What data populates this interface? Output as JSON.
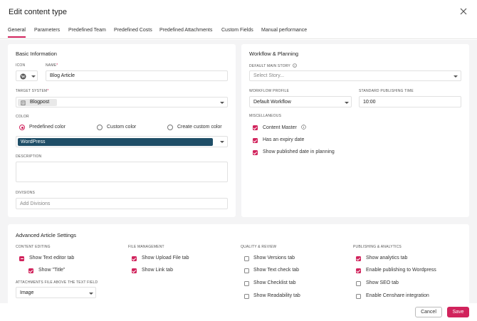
{
  "dialog": {
    "title": "Edit content type"
  },
  "tabs": [
    {
      "label": "General"
    },
    {
      "label": "Parameters"
    },
    {
      "label": "Predefined Team"
    },
    {
      "label": "Predefined Costs"
    },
    {
      "label": "Predefined Attachments"
    },
    {
      "label": "Custom Fields"
    },
    {
      "label": "Manual performance"
    }
  ],
  "basic": {
    "title": "Basic Information",
    "icon_label": "ICON",
    "icon_value": "W",
    "name_label": "NAME",
    "name_required": "*",
    "name_value": "Blog Article",
    "target_label": "TARGET SYSTEM",
    "target_required": "*",
    "target_value": "Blogpost",
    "color_label": "COLOR",
    "color_options": [
      "Predefined color",
      "Custom color",
      "Create custom color"
    ],
    "color_selected": "WordPress",
    "color_selected_bg": "#1f4e67",
    "description_label": "DESCRIPTION",
    "description_value": "",
    "divisions_label": "DIVISIONS",
    "divisions_placeholder": "Add Divisions"
  },
  "workflow": {
    "title": "Workflow & Planning",
    "main_story_label": "DEFAULT MAIN STORY",
    "main_story_placeholder": "Select Story...",
    "profile_label": "WORKFLOW PROFILE",
    "profile_value": "Default Workflow",
    "pubtime_label": "STANDARD PUBLISHING TIME",
    "pubtime_value": "10:00",
    "misc_label": "MISCELLANEOUS",
    "misc": [
      {
        "label": "Content Master",
        "checked": true
      },
      {
        "label": "Has an expiry date",
        "checked": true
      },
      {
        "label": "Show published date in planning",
        "checked": true
      }
    ]
  },
  "advanced": {
    "title": "Advanced Article Settings",
    "content_editing": {
      "label": "CONTENT EDITING",
      "items": [
        {
          "label": "Show Text editor tab",
          "state": "indeterminate"
        },
        {
          "label": "Show \"Title\"",
          "state": "checked"
        }
      ],
      "attach_label": "ATTACHMENTS FILE ABOVE THE TEXT FIELD",
      "attach_value": "Image"
    },
    "file_management": {
      "label": "FILE MANAGEMENT",
      "items": [
        {
          "label": "Show Upload File tab",
          "checked": true
        },
        {
          "label": "Show Link tab",
          "checked": true
        }
      ]
    },
    "quality_review": {
      "label": "QUALITY & REVIEW",
      "items": [
        {
          "label": "Show Versions tab",
          "checked": false
        },
        {
          "label": "Show Text check tab",
          "checked": false
        },
        {
          "label": "Show Checklist tab",
          "checked": false
        },
        {
          "label": "Show Readability tab",
          "checked": false
        }
      ]
    },
    "publishing": {
      "label": "PUBLISHING & ANALYTICS",
      "items": [
        {
          "label": "Show analytics tab",
          "checked": true
        },
        {
          "label": "Enable publishing to Wordpress",
          "checked": true
        },
        {
          "label": "Show SEO tab",
          "checked": false
        },
        {
          "label": "Enable Censhare integration",
          "checked": false
        }
      ]
    }
  },
  "footer": {
    "cancel_label": "Cancel",
    "save_label": "Save"
  },
  "colors": {
    "accent": "#d1235c",
    "wordpress": "#1f4e67",
    "page_bg": "#f4f4f5"
  }
}
